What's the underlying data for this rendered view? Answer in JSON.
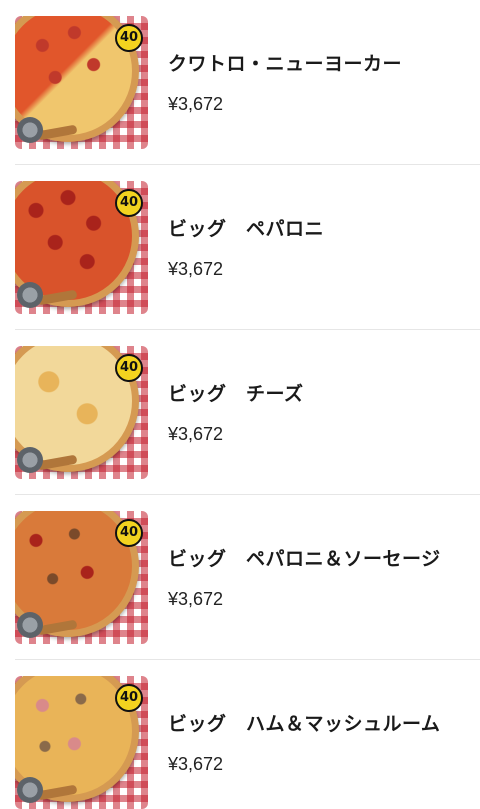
{
  "menu": {
    "items": [
      {
        "name": "クワトロ・ニューヨーカー",
        "price": "¥3,672",
        "badge": "40",
        "image_icon": "pizza-quattro-ny-icon"
      },
      {
        "name": "ビッグ　ペパロニ",
        "price": "¥3,672",
        "badge": "40",
        "image_icon": "pizza-pepperoni-icon"
      },
      {
        "name": "ビッグ　チーズ",
        "price": "¥3,672",
        "badge": "40",
        "image_icon": "pizza-cheese-icon"
      },
      {
        "name": "ビッグ　ペパロニ＆ソーセージ",
        "price": "¥3,672",
        "badge": "40",
        "image_icon": "pizza-pepperoni-sausage-icon"
      },
      {
        "name": "ビッグ　ハム＆マッシュルーム",
        "price": "¥3,672",
        "badge": "40",
        "image_icon": "pizza-ham-mushroom-icon"
      }
    ]
  },
  "colors": {
    "checker": "#c41e2e",
    "badge": "#f3d31f",
    "divider": "#e6e6e6"
  }
}
